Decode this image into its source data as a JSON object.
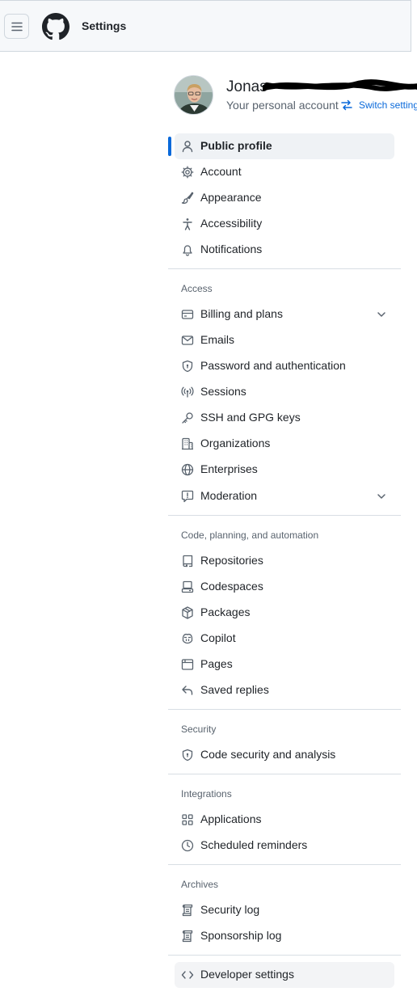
{
  "header": {
    "title": "Settings"
  },
  "profile": {
    "name": "Jonas",
    "subtitle": "Your personal account",
    "switch_label": "Switch settings"
  },
  "nav": {
    "main": [
      {
        "label": "Public profile",
        "icon": "person-icon",
        "active": true
      },
      {
        "label": "Account",
        "icon": "gear-icon"
      },
      {
        "label": "Appearance",
        "icon": "paintbrush-icon"
      },
      {
        "label": "Accessibility",
        "icon": "accessibility-icon"
      },
      {
        "label": "Notifications",
        "icon": "bell-icon"
      }
    ],
    "access": {
      "heading": "Access",
      "items": [
        {
          "label": "Billing and plans",
          "icon": "credit-card-icon",
          "expandable": true
        },
        {
          "label": "Emails",
          "icon": "mail-icon"
        },
        {
          "label": "Password and authentication",
          "icon": "shield-lock-icon"
        },
        {
          "label": "Sessions",
          "icon": "broadcast-icon"
        },
        {
          "label": "SSH and GPG keys",
          "icon": "key-icon"
        },
        {
          "label": "Organizations",
          "icon": "organization-icon"
        },
        {
          "label": "Enterprises",
          "icon": "globe-icon"
        },
        {
          "label": "Moderation",
          "icon": "report-icon",
          "expandable": true
        }
      ]
    },
    "code": {
      "heading": "Code, planning, and automation",
      "items": [
        {
          "label": "Repositories",
          "icon": "repo-icon"
        },
        {
          "label": "Codespaces",
          "icon": "codespaces-icon"
        },
        {
          "label": "Packages",
          "icon": "package-icon"
        },
        {
          "label": "Copilot",
          "icon": "copilot-icon"
        },
        {
          "label": "Pages",
          "icon": "browser-icon"
        },
        {
          "label": "Saved replies",
          "icon": "reply-icon"
        }
      ]
    },
    "security": {
      "heading": "Security",
      "items": [
        {
          "label": "Code security and analysis",
          "icon": "shield-lock-icon"
        }
      ]
    },
    "integrations": {
      "heading": "Integrations",
      "items": [
        {
          "label": "Applications",
          "icon": "apps-icon"
        },
        {
          "label": "Scheduled reminders",
          "icon": "clock-icon"
        }
      ]
    },
    "archives": {
      "heading": "Archives",
      "items": [
        {
          "label": "Security log",
          "icon": "log-icon"
        },
        {
          "label": "Sponsorship log",
          "icon": "log-icon"
        }
      ]
    },
    "developer": {
      "label": "Developer settings",
      "icon": "code-icon"
    }
  }
}
